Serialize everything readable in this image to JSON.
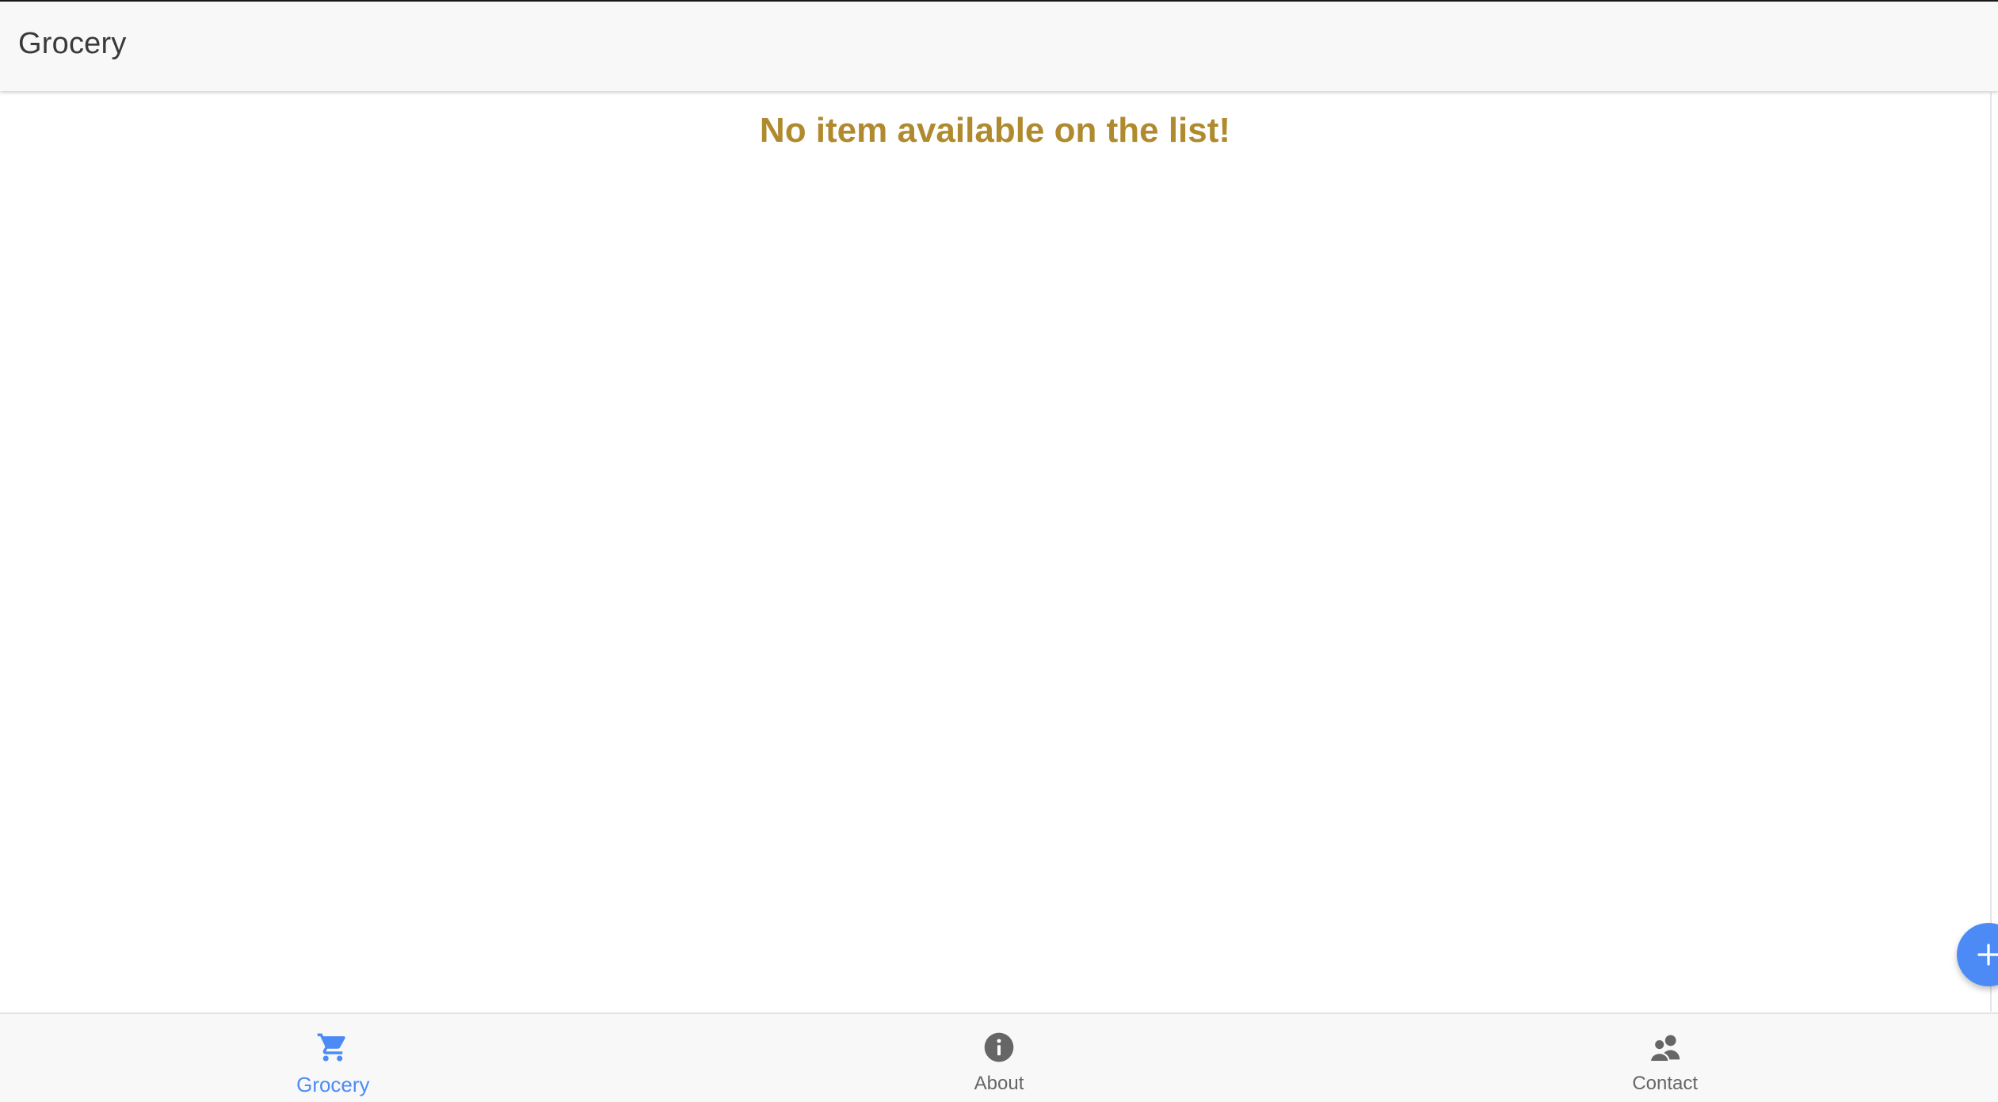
{
  "header": {
    "title": "Grocery"
  },
  "main": {
    "empty_message": "No item available on the list!"
  },
  "fab": {
    "icon": "plus-icon"
  },
  "tabs": [
    {
      "label": "Grocery",
      "icon": "cart-icon",
      "active": true
    },
    {
      "label": "About",
      "icon": "info-icon",
      "active": false
    },
    {
      "label": "Contact",
      "icon": "people-icon",
      "active": false
    }
  ],
  "colors": {
    "accent": "#4c8bf5",
    "empty_message": "#b08a2e",
    "inactive_tab": "#666666",
    "toolbar_bg": "#f8f8f8"
  }
}
